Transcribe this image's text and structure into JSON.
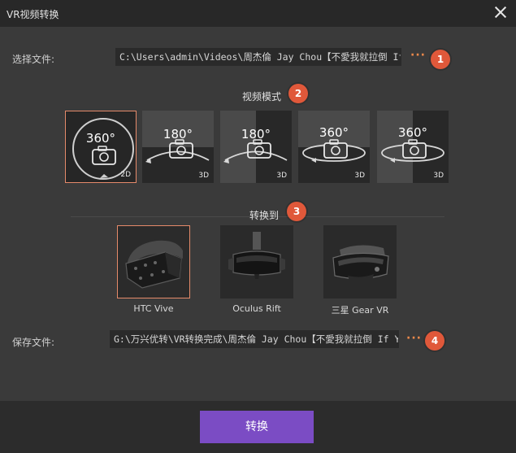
{
  "window": {
    "title": "VR视频转换"
  },
  "source": {
    "label": "选择文件:",
    "path": "C:\\Users\\admin\\Videos\\周杰倫 Jay Chou【不愛我就拉倒 If You Don",
    "browse": "···",
    "step": "1"
  },
  "video_mode": {
    "title": "视频模式",
    "step": "2",
    "modes": [
      {
        "deg": "360°",
        "dim": "2D",
        "layout": "full",
        "selected": true
      },
      {
        "deg": "180°",
        "dim": "3D",
        "layout": "top-bottom",
        "selected": false
      },
      {
        "deg": "180°",
        "dim": "3D",
        "layout": "left-right",
        "selected": false
      },
      {
        "deg": "360°",
        "dim": "3D",
        "layout": "top-bottom",
        "selected": false
      },
      {
        "deg": "360°",
        "dim": "3D",
        "layout": "left-right",
        "selected": false
      }
    ]
  },
  "convert_to": {
    "title": "转换到",
    "step": "3",
    "devices": [
      {
        "label": "HTC Vive",
        "icon": "htc-vive-headset-icon",
        "selected": true
      },
      {
        "label": "Oculus Rift",
        "icon": "oculus-rift-headset-icon",
        "selected": false
      },
      {
        "label": "三星 Gear VR",
        "icon": "gear-vr-headset-icon",
        "selected": false
      }
    ]
  },
  "output": {
    "label": "保存文件:",
    "path": "G:\\万兴优转\\VR转换完成\\周杰倫 Jay Chou【不愛我就拉倒 If You",
    "browse": "···",
    "step": "4"
  },
  "actions": {
    "convert_label": "转换"
  },
  "colors": {
    "accent": "#7b4cc4",
    "badge": "#e0583a",
    "selected_border": "#e58a6a",
    "dots": "#f08a4b"
  }
}
